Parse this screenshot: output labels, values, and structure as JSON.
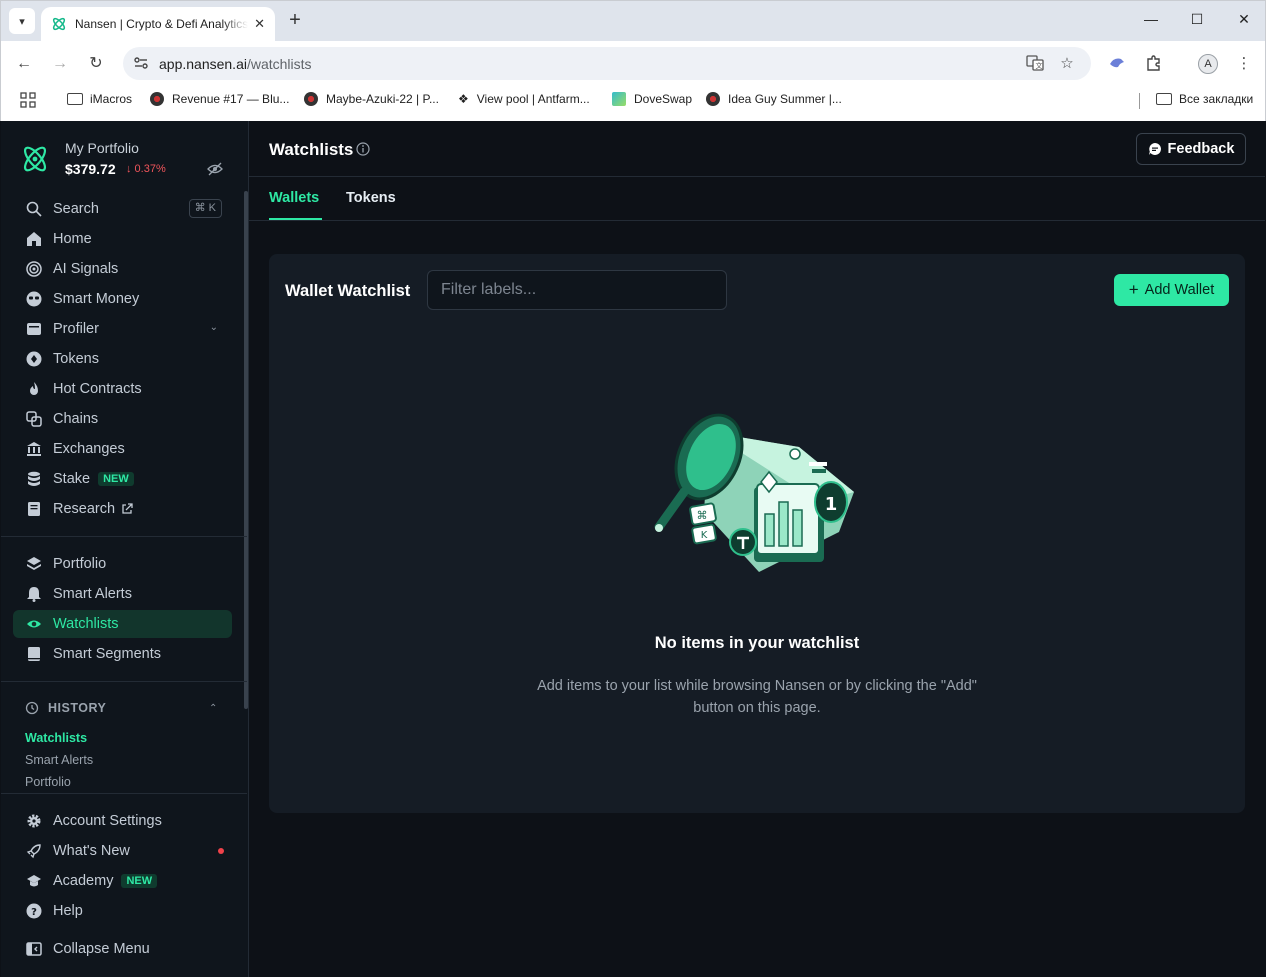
{
  "browser": {
    "tab_title": "Nansen | Crypto & Defi Analytics",
    "url_host": "app.nansen.ai",
    "url_path": "/watchlists",
    "profile_initial": "A",
    "bookmarks": [
      {
        "label": "iMacros",
        "icon": "folder-icon"
      },
      {
        "label": "Revenue #17 — Blu...",
        "icon": "eye-face-icon"
      },
      {
        "label": "Maybe-Azuki-22 | P...",
        "icon": "eye-face-icon"
      },
      {
        "label": "View pool | Antfarm...",
        "icon": "diamond-icon"
      },
      {
        "label": "DoveSwap",
        "icon": "chart-icon"
      },
      {
        "label": "Idea Guy Summer |...",
        "icon": "eye-face-icon"
      }
    ],
    "all_bookmarks": "Все закладки"
  },
  "portfolio": {
    "label": "My Portfolio",
    "value": "$379.72",
    "change": "↓ 0.37%"
  },
  "sidebar": {
    "search": {
      "label": "Search",
      "shortcut": "⌘ K"
    },
    "items": [
      {
        "label": "Home",
        "icon": "home-icon"
      },
      {
        "label": "AI Signals",
        "icon": "signal-icon"
      },
      {
        "label": "Smart Money",
        "icon": "sunglasses-icon"
      },
      {
        "label": "Profiler",
        "icon": "profile-card-icon"
      },
      {
        "label": "Tokens",
        "icon": "token-icon"
      },
      {
        "label": "Hot Contracts",
        "icon": "flame-icon"
      },
      {
        "label": "Chains",
        "icon": "chain-icon"
      },
      {
        "label": "Exchanges",
        "icon": "bank-icon"
      },
      {
        "label": "Stake",
        "icon": "database-icon",
        "badge": "NEW"
      },
      {
        "label": "Research",
        "icon": "document-icon"
      }
    ],
    "items2": [
      {
        "label": "Portfolio",
        "icon": "layers-icon"
      },
      {
        "label": "Smart Alerts",
        "icon": "bell-icon"
      },
      {
        "label": "Watchlists",
        "icon": "eye-icon"
      },
      {
        "label": "Smart Segments",
        "icon": "book-icon"
      }
    ],
    "history": {
      "title": "HISTORY",
      "links": [
        "Watchlists",
        "Smart Alerts",
        "Portfolio"
      ]
    },
    "bottom": [
      {
        "label": "Account Settings",
        "icon": "gear-icon"
      },
      {
        "label": "What's New",
        "icon": "rocket-icon"
      },
      {
        "label": "Academy",
        "icon": "graduation-cap-icon",
        "badge": "NEW"
      },
      {
        "label": "Help",
        "icon": "help-icon"
      },
      {
        "label": "Collapse Menu",
        "icon": "collapse-icon"
      }
    ]
  },
  "page": {
    "title": "Watchlists",
    "feedback_label": "Feedback",
    "tabs": [
      "Wallets",
      "Tokens"
    ],
    "card": {
      "title": "Wallet Watchlist",
      "filter_placeholder": "Filter labels...",
      "add_label": "Add Wallet"
    },
    "empty": {
      "title": "No items in your watchlist",
      "description": "Add items to your list while browsing Nansen or by clicking the \"Add\" button on this page."
    }
  },
  "colors": {
    "accent": "#2ee8a4",
    "background": "#0d1117",
    "card": "#151c25",
    "negative": "#f0555b"
  }
}
